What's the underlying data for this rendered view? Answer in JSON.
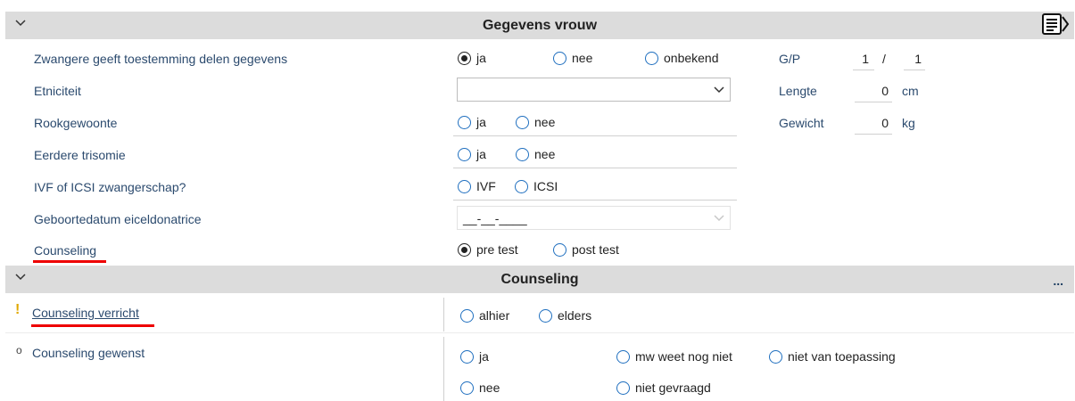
{
  "section1": {
    "title": "Gegevens vrouw",
    "consent_label": "Zwangere geeft toestemming delen gegevens",
    "consent_options": [
      "ja",
      "nee",
      "onbekend"
    ],
    "ethnicity_label": "Etniciteit",
    "ethnicity_value": "",
    "smoking_label": "Rookgewoonte",
    "smoking_options": [
      "ja",
      "nee"
    ],
    "trisomy_label": "Eerdere trisomie",
    "trisomy_options": [
      "ja",
      "nee"
    ],
    "ivf_label": "IVF of ICSI zwangerschap?",
    "ivf_options": [
      "IVF",
      "ICSI"
    ],
    "donor_label": "Geboortedatum eiceldonatrice",
    "donor_value": "__-__-____",
    "counseling_label": "Counseling",
    "counseling_options": [
      "pre test",
      "post test"
    ],
    "gp_label": "G/P",
    "gp_g": "1",
    "gp_sep": "/",
    "gp_p": "1",
    "length_label": "Lengte",
    "length_value": "0",
    "length_unit": "cm",
    "weight_label": "Gewicht",
    "weight_value": "0",
    "weight_unit": "kg"
  },
  "section2": {
    "title": "Counseling",
    "more": "...",
    "done_marker": "!",
    "done_label": "Counseling verricht",
    "done_options": [
      "alhier",
      "elders"
    ],
    "wish_marker": "o",
    "wish_label": "Counseling gewenst",
    "wish_options": [
      "ja",
      "mw weet nog niet",
      "niet van toepassing",
      "nee",
      "niet gevraagd"
    ]
  },
  "colors": {
    "accent": "#1f6fbf",
    "warning": "#e0a800",
    "highlight": "#e00000"
  }
}
